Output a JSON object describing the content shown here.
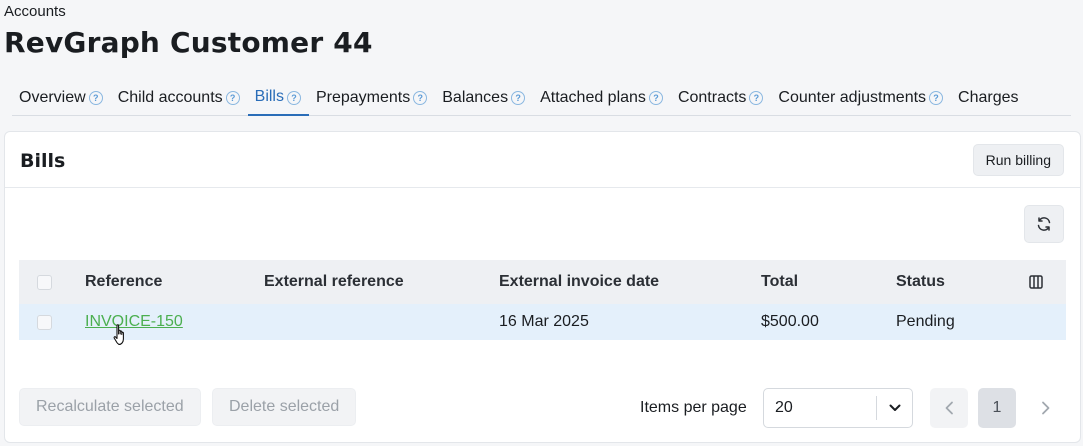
{
  "breadcrumb": "Accounts",
  "page_title": "RevGraph Customer 44",
  "tabs": [
    {
      "label": "Overview",
      "help": true
    },
    {
      "label": "Child accounts",
      "help": true
    },
    {
      "label": "Bills",
      "help": true,
      "active": true
    },
    {
      "label": "Prepayments",
      "help": true
    },
    {
      "label": "Balances",
      "help": true
    },
    {
      "label": "Attached plans",
      "help": true
    },
    {
      "label": "Contracts",
      "help": true
    },
    {
      "label": "Counter adjustments",
      "help": true
    },
    {
      "label": "Charges",
      "help": false
    }
  ],
  "help_glyph": "?",
  "card": {
    "title": "Bills",
    "run_billing_label": "Run billing",
    "refresh_icon": "refresh-icon"
  },
  "table": {
    "columns": [
      "Reference",
      "External reference",
      "External invoice date",
      "Total",
      "Status"
    ],
    "rows": [
      {
        "reference": "INVOICE-150",
        "external_reference": "",
        "external_invoice_date": "16 Mar 2025",
        "total": "$500.00",
        "status": "Pending",
        "selected": false
      }
    ]
  },
  "footer": {
    "recalculate_label": "Recalculate selected",
    "delete_label": "Delete selected",
    "items_per_page_label": "Items per page",
    "items_per_page_value": "20",
    "current_page": "1"
  },
  "colors": {
    "accent": "#2a6db8",
    "link": "#4caf50",
    "selected_row": "#e4f0fb"
  }
}
